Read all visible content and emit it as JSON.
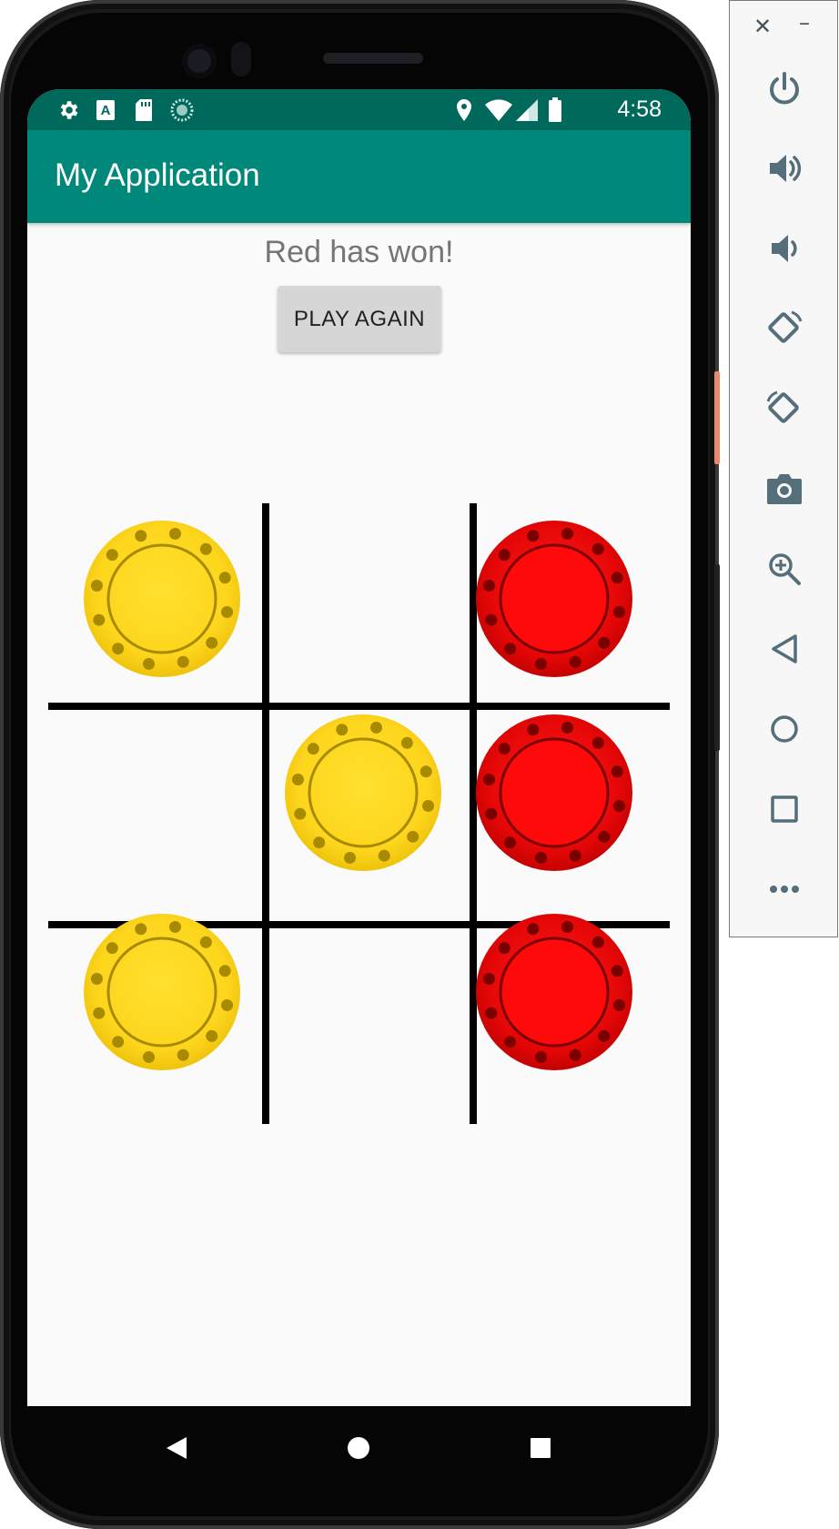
{
  "statusbar": {
    "time": "4:58",
    "icons": [
      "settings-icon",
      "text-a-icon",
      "sd-card-icon",
      "sync-icon",
      "location-icon",
      "wifi-icon",
      "signal-icon",
      "battery-icon"
    ]
  },
  "appbar": {
    "title": "My Application"
  },
  "game": {
    "status_text": "Red has won!",
    "play_again_label": "PLAY AGAIN",
    "board": [
      [
        "yellow",
        "",
        "red"
      ],
      [
        "",
        "yellow",
        "red"
      ],
      [
        "yellow",
        "",
        "red"
      ]
    ],
    "colors": {
      "yellow": "#fdd51c",
      "red": "#ff0a0a",
      "app_bar": "#00897b",
      "status_bar": "#00695c"
    }
  },
  "navbar": {
    "buttons": [
      "back-icon",
      "home-icon",
      "recents-icon"
    ]
  },
  "emulator_toolbar": {
    "window_controls": [
      "close-icon",
      "minimize-icon"
    ],
    "buttons": [
      "power-icon",
      "volume-up-icon",
      "volume-down-icon",
      "rotate-left-icon",
      "rotate-right-icon",
      "camera-icon",
      "zoom-icon",
      "back-icon",
      "home-icon",
      "overview-icon",
      "more-icon"
    ]
  }
}
